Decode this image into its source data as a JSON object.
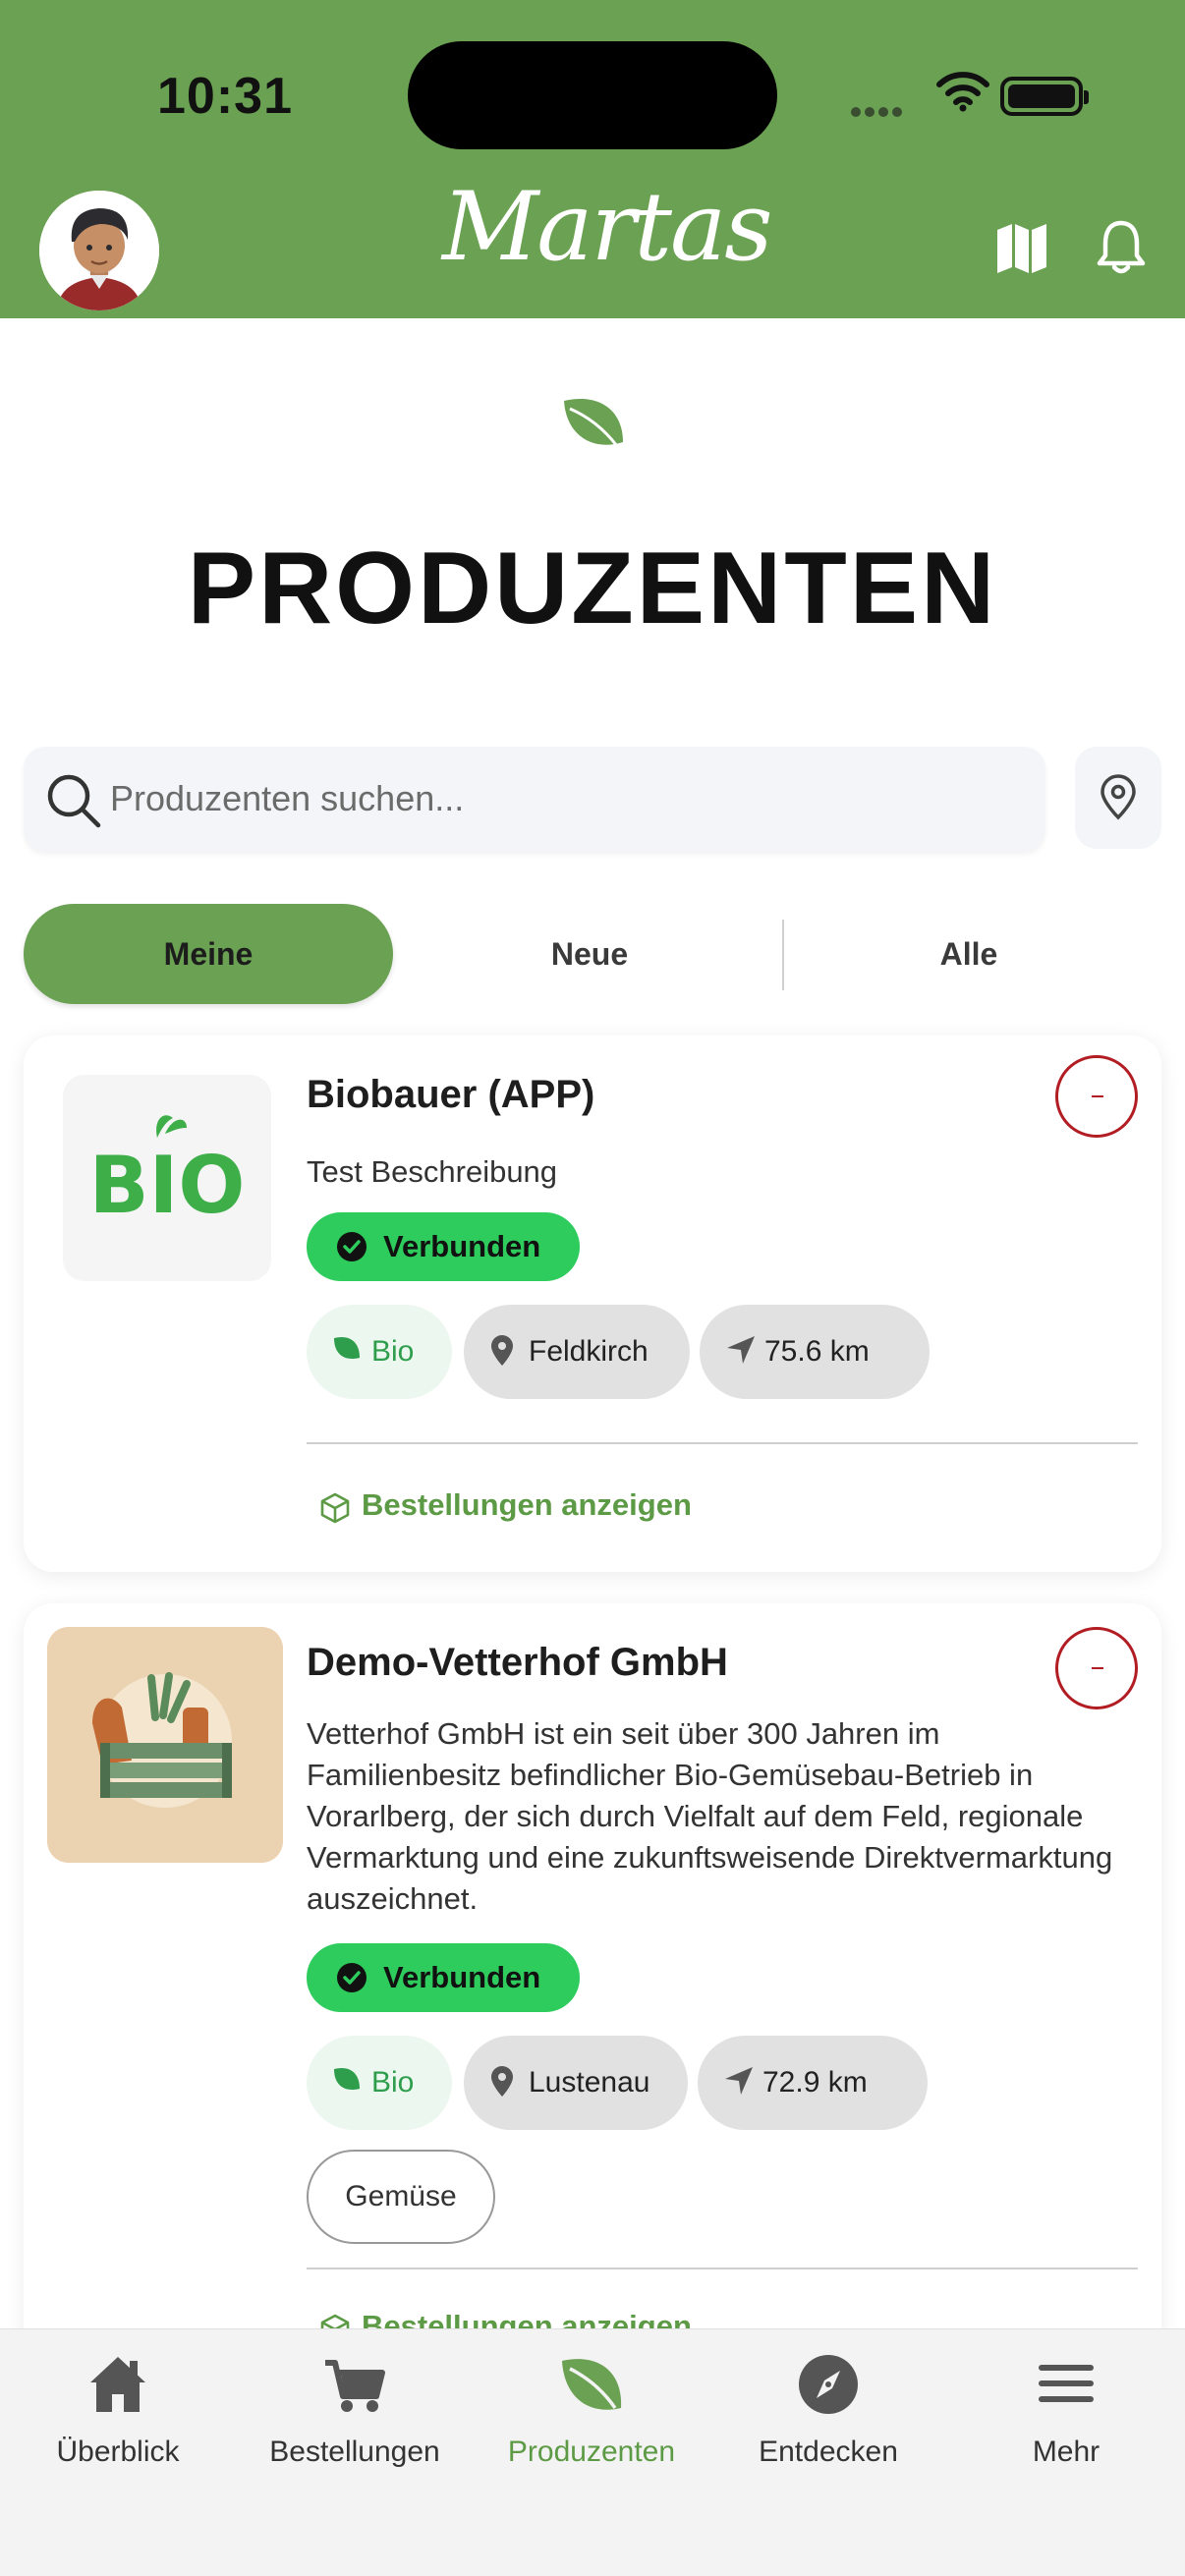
{
  "status_bar": {
    "time": "10:31"
  },
  "header": {
    "logo_text": "Martas",
    "brand_color": "#6aa152",
    "icons": [
      "avatar",
      "map-icon",
      "bell-icon"
    ]
  },
  "page": {
    "title": "PRODUZENTEN"
  },
  "search": {
    "placeholder": "Produzenten suchen...",
    "value": ""
  },
  "tabs": [
    {
      "label": "Meine",
      "active": true
    },
    {
      "label": "Neue",
      "active": false
    },
    {
      "label": "Alle",
      "active": false
    }
  ],
  "producers": [
    {
      "name": "Biobauer (APP)",
      "description": "Test Beschreibung",
      "status": "Verbunden",
      "logo_text": "BIO",
      "chips": {
        "bio": "Bio",
        "location": "Feldkirch",
        "distance": "75.6 km"
      },
      "tags": [],
      "orders_link": "Bestellungen anzeigen"
    },
    {
      "name": "Demo-Vetterhof GmbH",
      "description": "Vetterhof GmbH ist ein seit über 300 Jahren im Familienbesitz befindlicher Bio-Gemüsebau-Betrieb in Vorarlberg, der sich durch Vielfalt auf dem Feld, regionale Vermarktung und eine zukunftsweisende Direktvermarktung auszeichnet.",
      "status": "Verbunden",
      "chips": {
        "bio": "Bio",
        "location": "Lustenau",
        "distance": "72.9 km"
      },
      "tags": [
        "Gemüse"
      ],
      "orders_link": "Bestellungen anzeigen"
    }
  ],
  "bottom_nav": [
    {
      "label": "Überblick",
      "icon": "home-icon",
      "active": false
    },
    {
      "label": "Bestellungen",
      "icon": "cart-icon",
      "active": false
    },
    {
      "label": "Produzenten",
      "icon": "leaf-icon",
      "active": true
    },
    {
      "label": "Entdecken",
      "icon": "compass-icon",
      "active": false
    },
    {
      "label": "Mehr",
      "icon": "menu-icon",
      "active": false
    }
  ],
  "colors": {
    "accent": "#6aa152",
    "connected": "#2ecc5c",
    "remove": "#b21d24",
    "bio_text": "#2e9e4d"
  }
}
